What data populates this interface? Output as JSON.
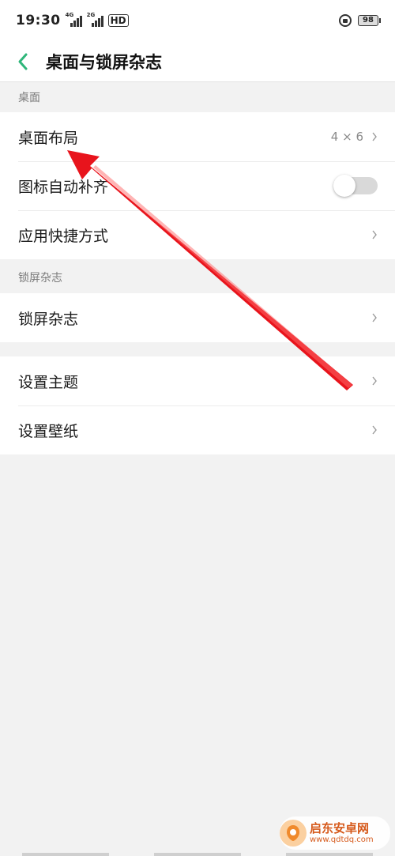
{
  "statusbar": {
    "time": "19:30",
    "sig1_tag": "4G",
    "sig2_tag": "2G",
    "hd": "HD",
    "battery": "98"
  },
  "header": {
    "title": "桌面与锁屏杂志"
  },
  "sections": {
    "desktop_label": "桌面",
    "lockscreen_label": "锁屏杂志"
  },
  "rows": {
    "desktop_layout": {
      "label": "桌面布局",
      "value": "4 × 6"
    },
    "auto_fill": {
      "label": "图标自动补齐",
      "enabled": false
    },
    "shortcuts": {
      "label": "应用快捷方式"
    },
    "lock_magazine": {
      "label": "锁屏杂志"
    },
    "theme": {
      "label": "设置主题"
    },
    "wallpaper": {
      "label": "设置壁纸"
    }
  },
  "colors": {
    "accent": "#2fb67a",
    "annotation_arrow": "#e8141c"
  },
  "watermark": {
    "title": "启东安卓网",
    "url": "www.qdtdq.com"
  }
}
